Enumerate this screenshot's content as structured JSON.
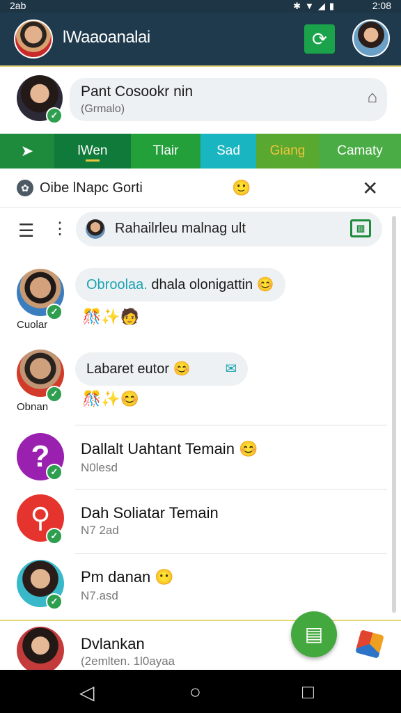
{
  "status_bar": {
    "left": "2ab",
    "right": "2:08"
  },
  "app_bar": {
    "title": "lWaaoanalai"
  },
  "profile": {
    "name": "Pant Cosookr nin",
    "subtitle": "(Grmalo)"
  },
  "tabs": [
    {
      "label": ""
    },
    {
      "label": "lWen"
    },
    {
      "label": "Tlair"
    },
    {
      "label": "Sad"
    },
    {
      "label": "Giang"
    },
    {
      "label": "Camaty"
    }
  ],
  "banner": {
    "text": "Oibe lNapc Gorti"
  },
  "search": {
    "text": "Rahailrleu malnag ult"
  },
  "chats": [
    {
      "label": "Cuolar",
      "bubble_highlight": "Obroolaa.",
      "bubble_text": " dhala olonigattin"
    },
    {
      "label": "Obnan",
      "bubble_text": "Labaret eutor"
    },
    {
      "title": "Dallalt Uahtant Temain",
      "subtitle": "N0lesd"
    },
    {
      "title": "Dah Soliatar Temain",
      "subtitle": "N7 2ad"
    },
    {
      "title": "Pm danan",
      "subtitle": "N7.asd"
    },
    {
      "title": "Dvlankan",
      "subtitle": "(2emlten. 1l0ayaa"
    }
  ],
  "colors": {
    "appbar": "#1f3a4c",
    "accent_green": "#1e8a3c",
    "teal_tab": "#19b6c2"
  }
}
